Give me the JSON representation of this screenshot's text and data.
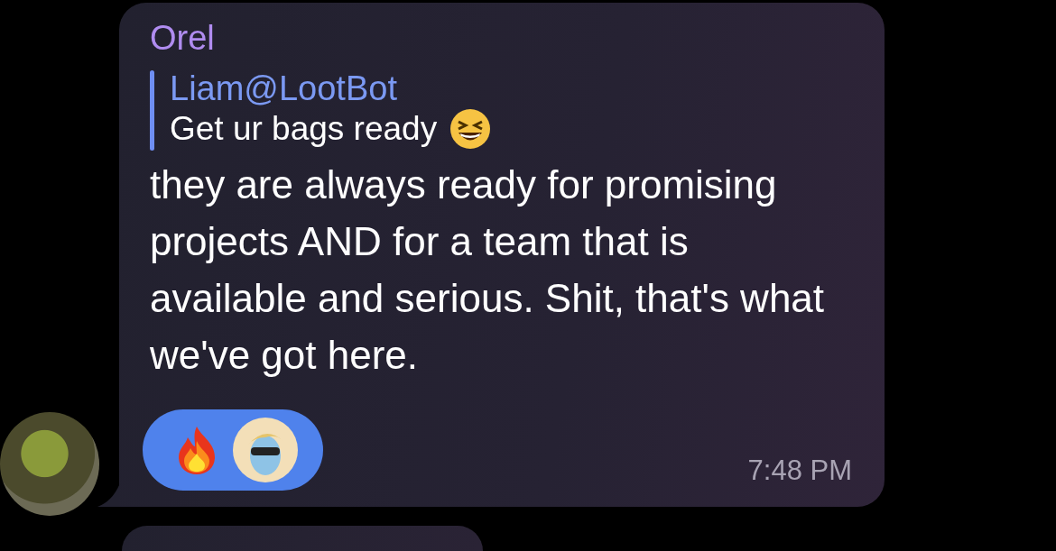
{
  "message": {
    "sender": "Orel",
    "reply": {
      "author": "Liam@LootBot",
      "text": "Get ur bags ready"
    },
    "text": "they are always ready for promising projects AND for a team that is available and serious. Shit, that's what we've got here.",
    "reactions": {
      "selected": true,
      "items": [
        {
          "kind": "emoji"
        },
        {
          "kind": "avatar"
        }
      ]
    },
    "time": "7:48 PM"
  }
}
